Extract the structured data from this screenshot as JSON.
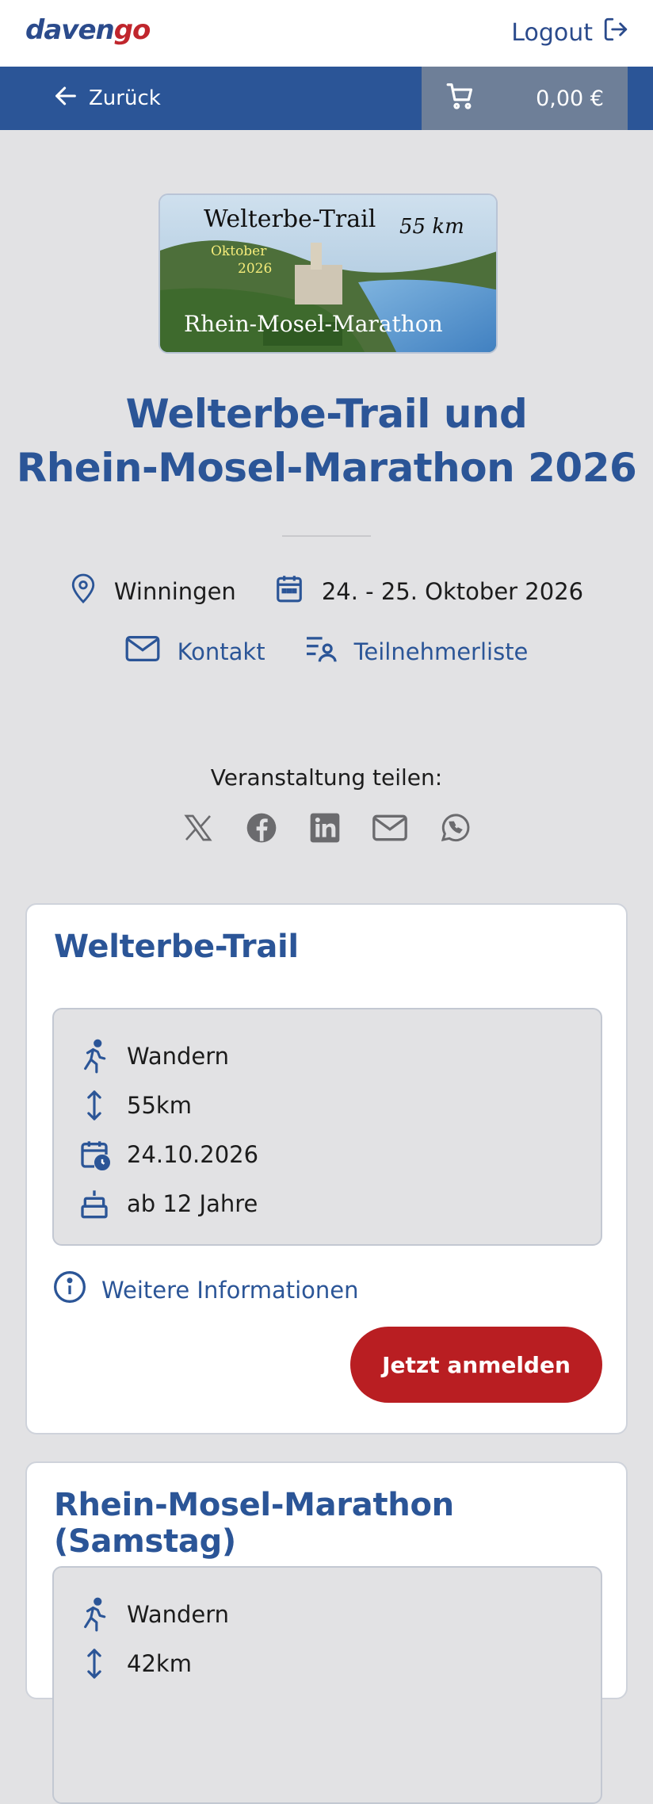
{
  "brand": {
    "logo_part1": "daven",
    "logo_part2": "go"
  },
  "header": {
    "logout_label": "Logout"
  },
  "nav": {
    "back_label": "Zurück",
    "cart_total": "0,00 €"
  },
  "hero": {
    "banner_title": "Welterbe-Trail",
    "banner_distance": "55 km",
    "banner_month": "Oktober",
    "banner_year": "2026",
    "banner_subtitle": "Rhein-Mosel-Marathon"
  },
  "event": {
    "title_line1": "Welterbe-Trail und",
    "title_line2": "Rhein-Mosel-Marathon 2026",
    "location": "Winningen",
    "dates": "24. - 25. Oktober 2026",
    "contact_label": "Kontakt",
    "participants_label": "Teilnehmerliste"
  },
  "share": {
    "label": "Veranstaltung teilen:",
    "icons": [
      "x-icon",
      "facebook-icon",
      "linkedin-icon",
      "mail-icon",
      "whatsapp-icon"
    ]
  },
  "races": [
    {
      "title": "Welterbe-Trail",
      "type": "Wandern",
      "distance": "55km",
      "date": "24.10.2026",
      "age": "ab 12 Jahre",
      "more_info": "Weitere Informationen",
      "signup": "Jetzt anmelden"
    },
    {
      "title": "Rhein-Mosel-Marathon (Samstag)",
      "type": "Wandern",
      "distance": "42km"
    }
  ],
  "colors": {
    "primary": "#2b5597",
    "accent": "#b91e22",
    "background": "#e2e2e4",
    "cart_bg": "#6e7f98"
  }
}
